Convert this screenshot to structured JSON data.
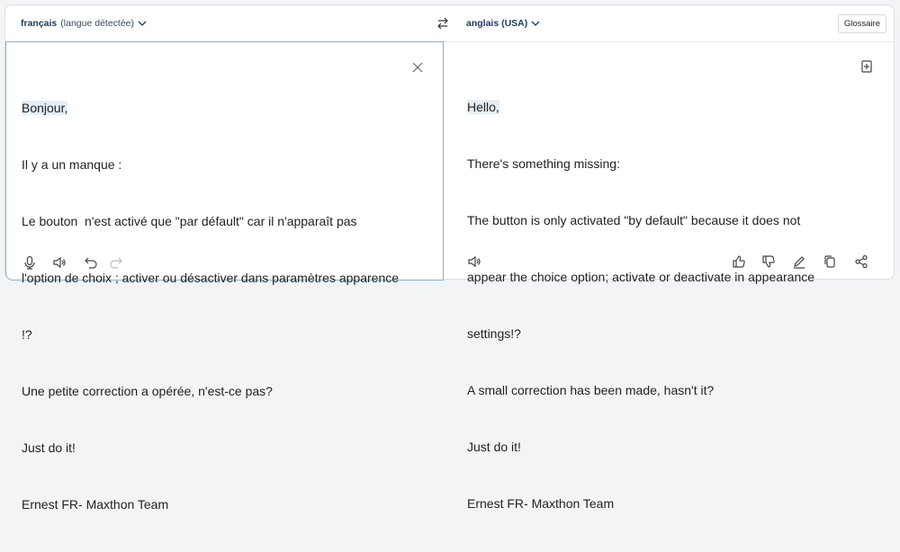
{
  "source": {
    "language": "français",
    "language_note": "(langue détectée)",
    "lines": [
      "Bonjour,",
      "Il y a un manque :",
      "Le bouton  n'est activé que \"par défault\" car il n'apparaît pas",
      "l'option de choix ; activer ou désactiver dans paramètres apparence",
      "!?",
      "Une petite correction a opérée, n'est-ce pas?",
      "Just do it!",
      "Ernest FR- Maxthon Team"
    ]
  },
  "target": {
    "language": "anglais (USA)",
    "glossary_label": "Glossaire",
    "lines": [
      "Hello,",
      "There's something missing:",
      "The button is only activated \"by default\" because it does not",
      "appear the choice option; activate or deactivate in appearance",
      "settings!?",
      "A small correction has been made, hasn't it?",
      "Just do it!",
      "Ernest FR- Maxthon Team"
    ]
  }
}
